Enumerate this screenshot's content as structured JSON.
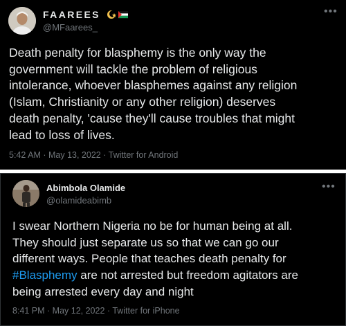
{
  "tweets": [
    {
      "display_name": "FAAREES",
      "handle": "@MFaarees_",
      "lines": [
        "Death penalty for blasphemy is the only way the",
        "government will tackle the problem of religious",
        "intolerance, whoever blasphemes against any religion",
        "(Islam, Christianity or any other religion) deserves",
        "death penalty, 'cause they'll cause troubles that might",
        "lead to loss of lives."
      ],
      "time": "5:42 AM",
      "date": "May 13, 2022",
      "source": "Twitter for Android",
      "more_icon": "more-horizontal-icon"
    },
    {
      "display_name": "Abimbola Olamide",
      "handle": "@olamideabimb",
      "lines": [
        "I swear Northern Nigeria no be for human being at all.",
        "They should just separate us so that we can go our",
        "different ways. People that teaches death penalty for",
        "",
        "being arrested every day and night"
      ],
      "line4_hashtag": "#Blasphemy",
      "line4_rest": " are not arrested but freedom agitators are",
      "time": "8:41 PM",
      "date": "May 12, 2022",
      "source": "Twitter for iPhone",
      "more_icon": "more-horizontal-icon"
    }
  ],
  "separator": " · ",
  "colors": {
    "background": "#000000",
    "text": "#e7e9ea",
    "secondary": "#71767b",
    "hashtag": "#1d9bf0"
  }
}
